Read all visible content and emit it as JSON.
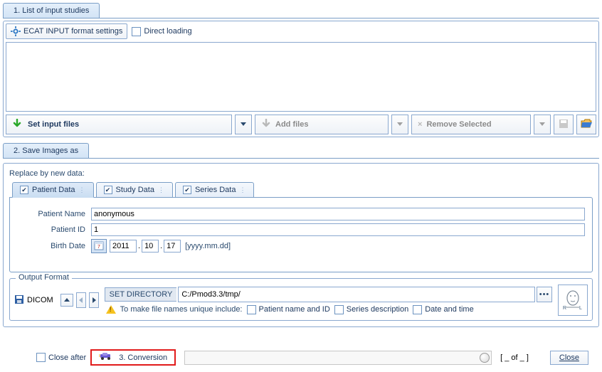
{
  "section1": {
    "tab_label": "1. List of input studies",
    "ecat_btn": "ECAT INPUT format settings",
    "direct_loading": "Direct loading",
    "set_input_files": "Set input files",
    "add_files": "Add files",
    "remove_selected": "Remove Selected"
  },
  "section2": {
    "tab_label": "2. Save Images as",
    "replace_label": "Replace by new data:",
    "tabs": {
      "patient": "Patient Data",
      "study": "Study Data",
      "series": "Series Data"
    },
    "patient_form": {
      "name_label": "Patient Name",
      "name_value": "anonymous",
      "id_label": "Patient ID",
      "id_value": "1",
      "birth_label": "Birth Date",
      "year": "2011",
      "month": "10",
      "day": "17",
      "format_hint": "[yyyy.mm.dd]"
    },
    "output": {
      "legend": "Output Format",
      "dicom_label": "DICOM",
      "set_dir": "SET DIRECTORY",
      "dir_value": "C:/Pmod3.3/tmp/",
      "hint_prefix": "To make file names unique include:",
      "opt_patient": "Patient name and ID",
      "opt_series": "Series description",
      "opt_datetime": "Date and time"
    }
  },
  "bottom": {
    "close_after": "Close after",
    "conversion": "3. Conversion",
    "page_indicator": "[ _ of _ ]",
    "close": "Close"
  },
  "icons": {
    "gear": "gear-icon",
    "arrow_down_green": "download-arrow-icon",
    "arrow_down_grey": "download-arrow-disabled-icon",
    "x_grey": "remove-disabled-icon",
    "disk": "save-disabled-icon",
    "folder": "open-folder-icon",
    "calendar": "calendar-icon",
    "disk_blue": "disk-icon",
    "up": "collapse-up-icon",
    "prev": "prev-icon",
    "next": "next-icon",
    "dots": "more-icon",
    "warning": "warning-icon",
    "orient": "orientation-icon",
    "car": "car-icon",
    "knob": "progress-knob-icon"
  }
}
